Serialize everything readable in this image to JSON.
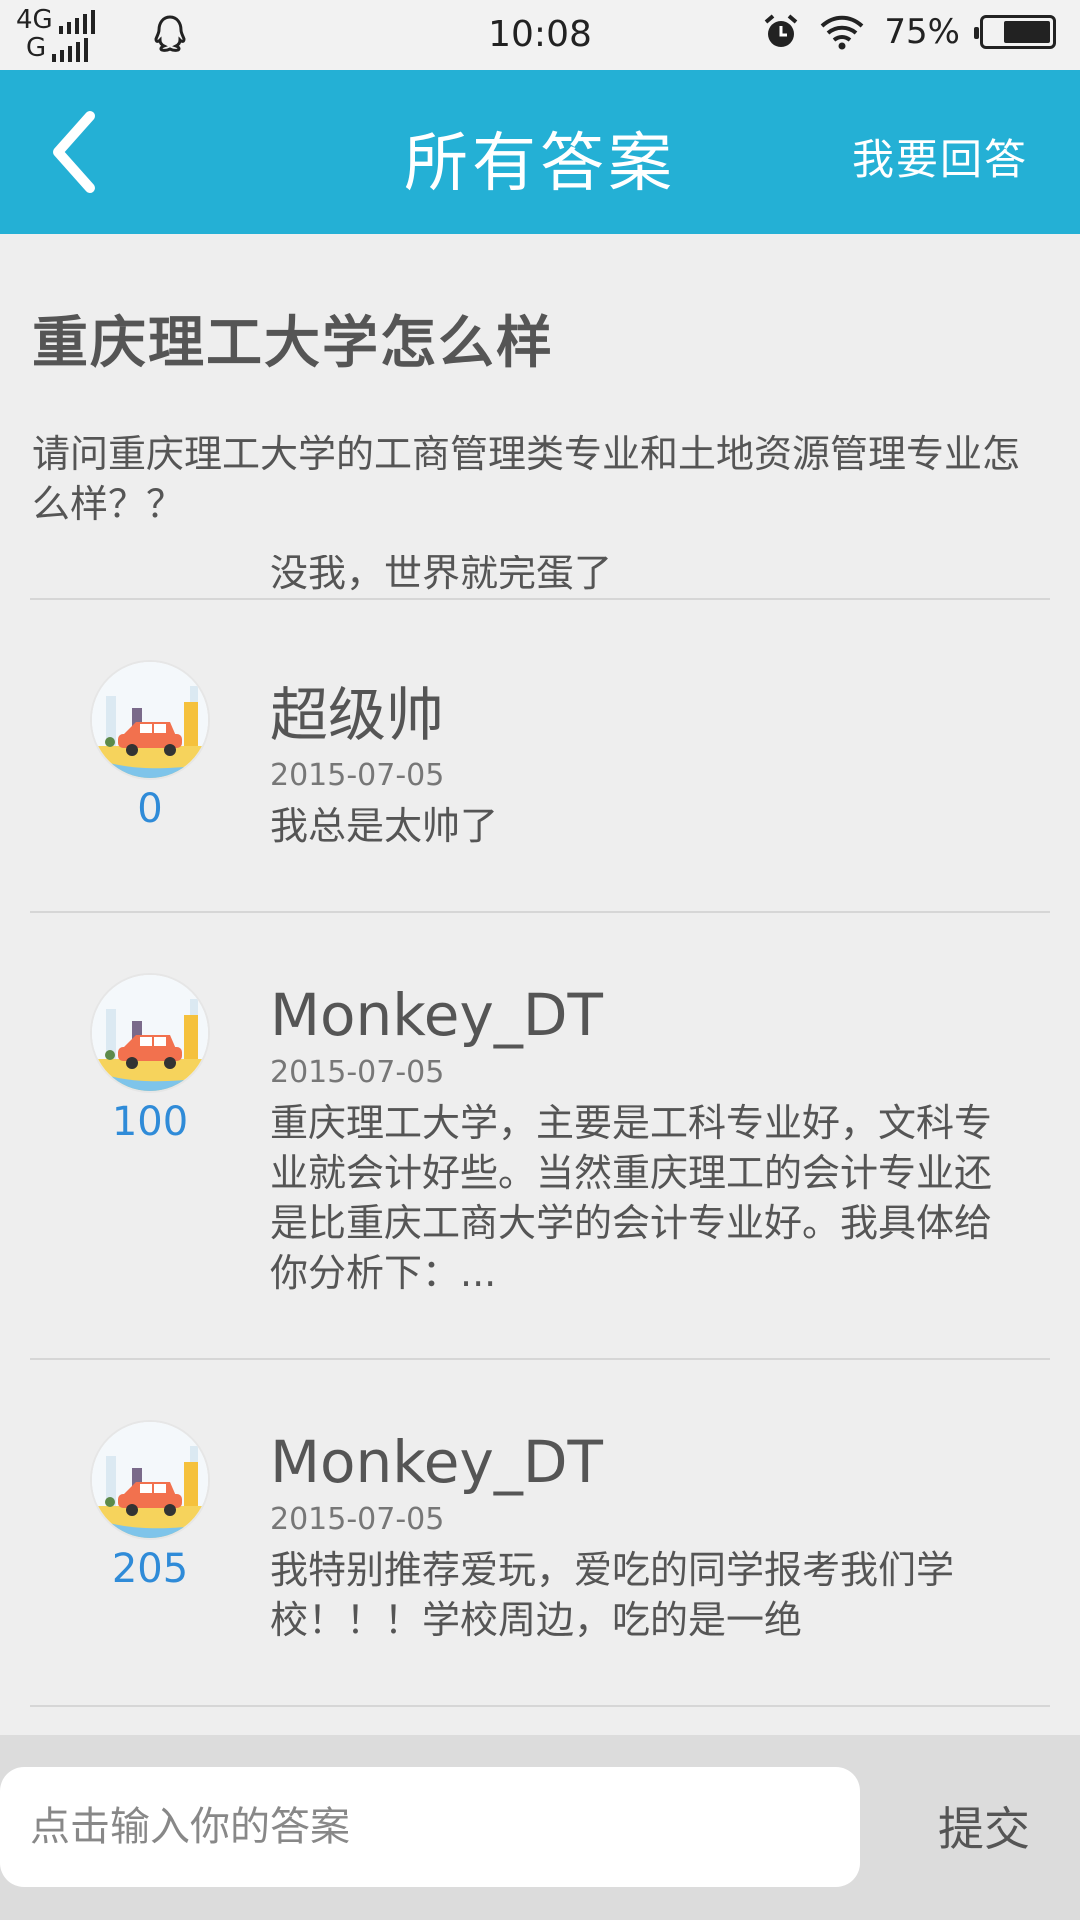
{
  "status_bar": {
    "network_top": "4G",
    "network_bottom": "G",
    "time": "10:08",
    "battery": "75%",
    "battery_level": 0.75
  },
  "app_bar": {
    "title": "所有答案",
    "action": "我要回答"
  },
  "question": {
    "title": "重庆理工大学怎么样",
    "description": "请问重庆理工大学的工商管理类专业和土地资源管理专业怎么样？？"
  },
  "answers": [
    {
      "votes": "0",
      "name": "",
      "date": "",
      "content": "没我，世界就完蛋了"
    },
    {
      "votes": "0",
      "name": "超级帅",
      "date": "2015-07-05",
      "content": "我总是太帅了"
    },
    {
      "votes": "100",
      "name": "Monkey_DT",
      "date": "2015-07-05",
      "content": "重庆理工大学，主要是工科专业好，文科专业就会计好些。当然重庆理工的会计专业还是比重庆工商大学的会计专业好。我具体给你分析下：..."
    },
    {
      "votes": "205",
      "name": "Monkey_DT",
      "date": "2015-07-05",
      "content": "我特别推荐爱玩，爱吃的同学报考我们学校！！！学校周边，吃的是一绝"
    }
  ],
  "input_bar": {
    "placeholder": "点击输入你的答案",
    "submit_label": "提交"
  },
  "colors": {
    "app_bar": "#24b0d5",
    "votes": "#2f8bd8"
  }
}
